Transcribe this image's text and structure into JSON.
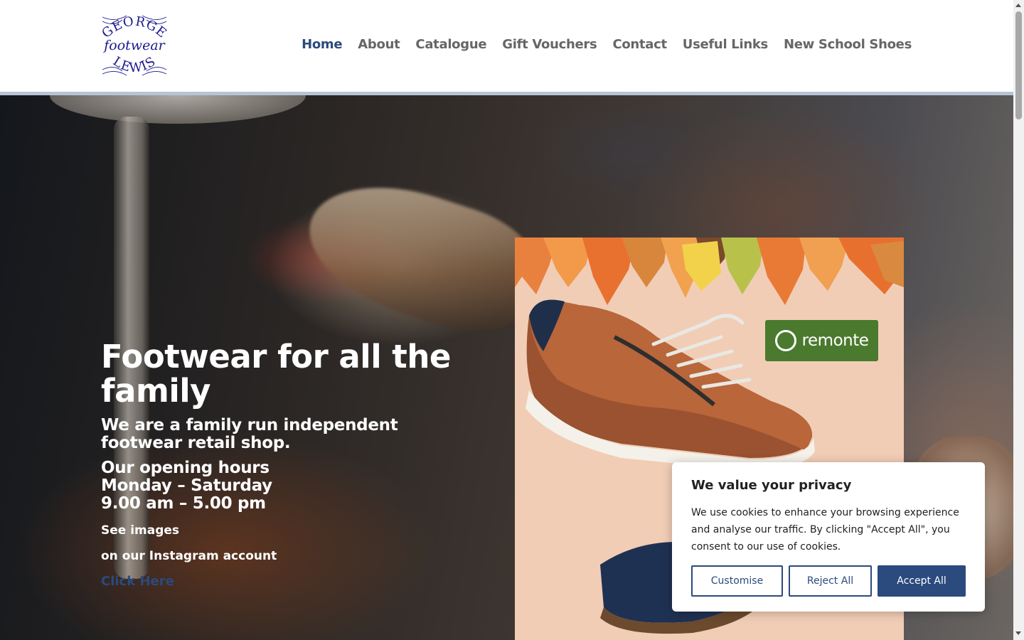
{
  "logo": {
    "top_text": "GEORGE",
    "middle_text": "footwear",
    "bottom_text": "LEWIS"
  },
  "nav": {
    "items": [
      {
        "label": "Home",
        "active": true
      },
      {
        "label": "About"
      },
      {
        "label": "Catalogue"
      },
      {
        "label": "Gift Vouchers"
      },
      {
        "label": "Contact"
      },
      {
        "label": "Useful Links"
      },
      {
        "label": "New School Shoes"
      }
    ]
  },
  "hero": {
    "title": "Footwear for all the family",
    "subtitle": "We are a family run independent footwear retail shop.",
    "hours_heading": "Our opening hours",
    "hours_days": "Monday – Saturday",
    "hours_time": "9.00 am – 5.00 pm",
    "see_images": "See images",
    "instagram_text": "on our Instagram account",
    "link_label": "Click Here"
  },
  "promo": {
    "brand": "remonte"
  },
  "cookie": {
    "title": "We value your privacy",
    "body": "We use cookies to enhance your browsing experience and analyse our traffic. By clicking \"Accept All\", you consent to our use of cookies.",
    "customise_label": "Customise",
    "reject_label": "Reject All",
    "accept_label": "Accept All"
  },
  "colors": {
    "accent": "#2b4a7d",
    "nav_text": "#666666",
    "logo_blue": "#1a1a8c",
    "brand_green": "#4a7a2e"
  }
}
